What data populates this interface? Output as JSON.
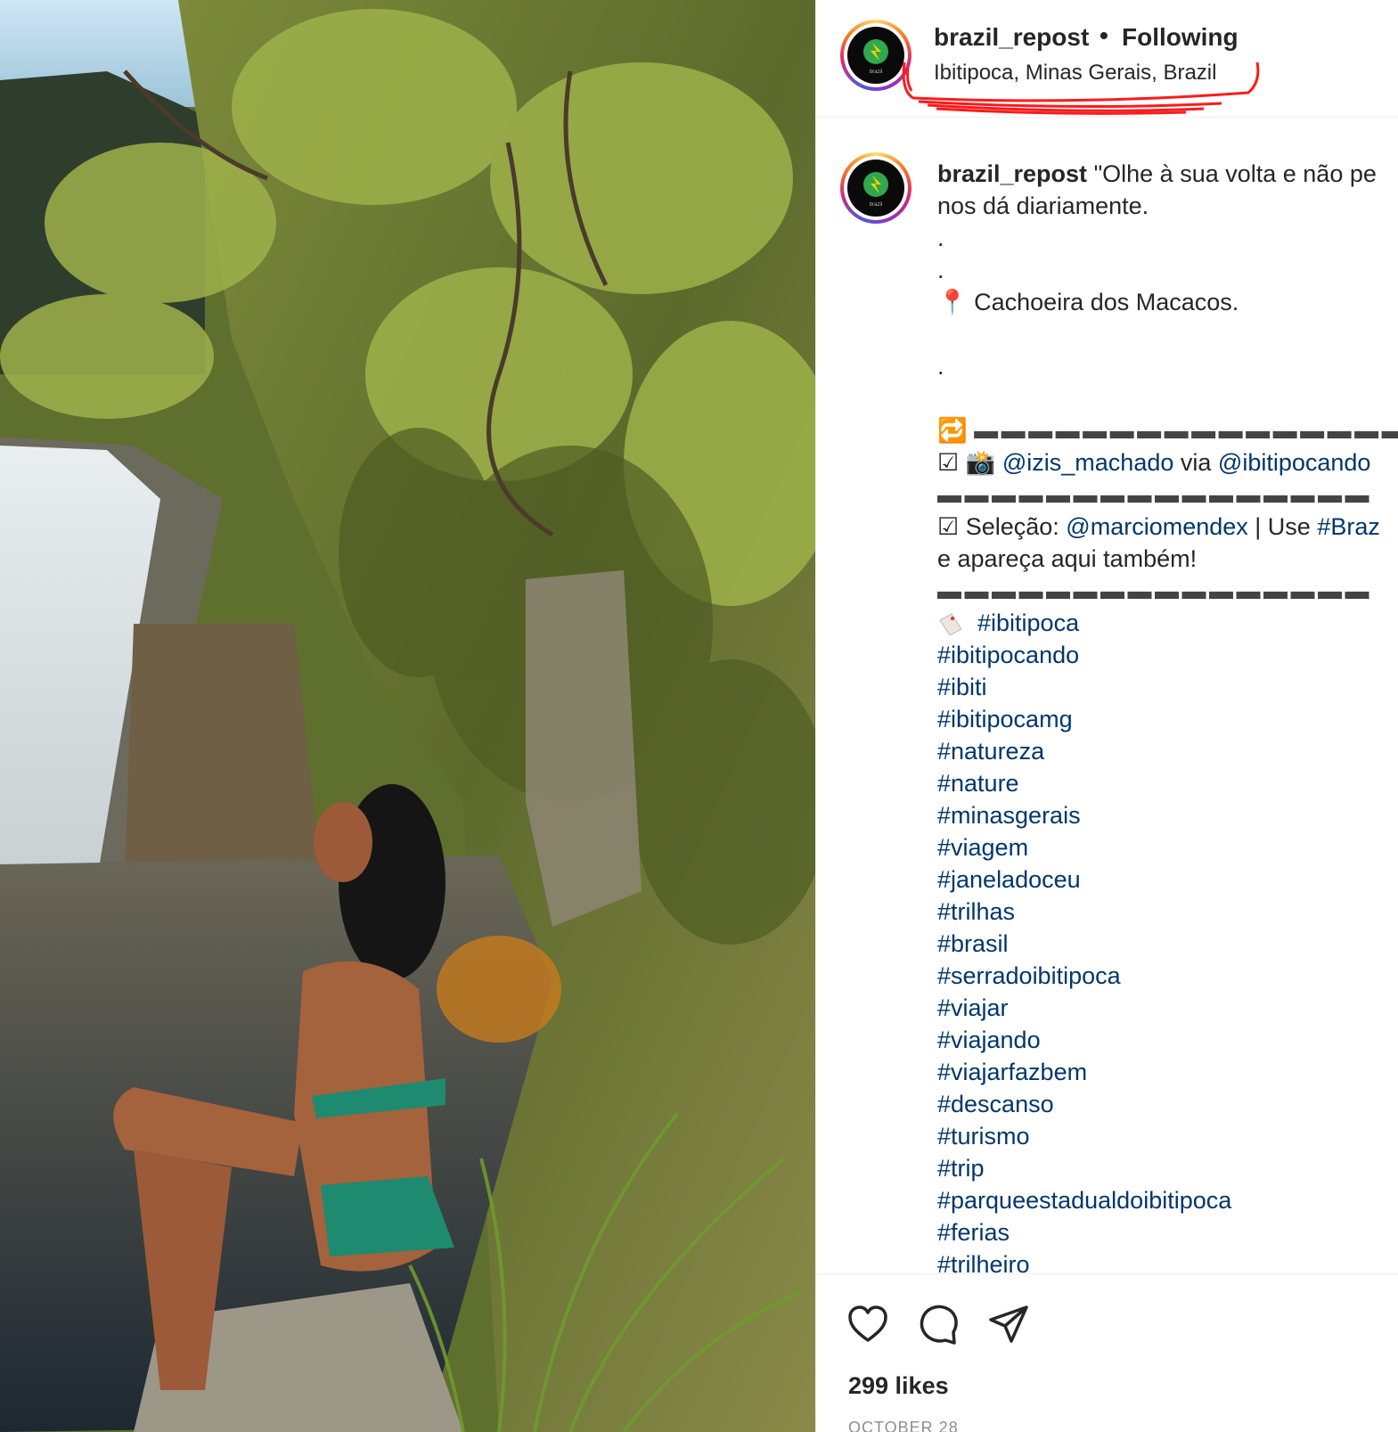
{
  "post": {
    "username": "brazil_repost",
    "separator": "•",
    "follow_state": "Following",
    "location": "Ibitipoca, Minas Gerais, Brazil",
    "avatar_text": "brazil"
  },
  "caption": {
    "username": "brazil_repost",
    "line1_text": " \"Olhe à sua volta e não pe",
    "line2_text": "nos dá diariamente.",
    "dot": ".",
    "pin_icon": "📍",
    "place": " Cachoeira dos Macacos.",
    "repost_icon": "🔁",
    "dash_line": "▬ ▬ ▬ ▬ ▬ ▬ ▬ ▬ ▬ ▬ ▬ ▬ ▬ ▬ ▬ ▬",
    "check": "☑",
    "camera_icon": "📸",
    "photo_by": "@izis_machado",
    "via": " via ",
    "via_handle": "@ibitipocando",
    "selection_label": " Seleção: ",
    "selection_handle": "@marciomendex",
    "use_text": " | Use ",
    "use_tag": "#Braz",
    "appear_text": "e apareça aqui também!",
    "hashtags": [
      "#ibitipoca",
      "#ibitipocando",
      "#ibiti",
      "#ibitipocamg",
      "#natureza",
      "#nature",
      "#minasgerais",
      "#viagem",
      "#janeladoceu",
      "#trilhas",
      "#brasil",
      "#serradoibitipoca",
      "#viajar",
      "#viajando",
      "#viajarfazbem",
      "#descanso",
      "#turismo",
      "#trip",
      "#parqueestadualdoibitipoca",
      "#ferias",
      "#trilheiro"
    ]
  },
  "actions": {
    "like_icon": "heart-icon",
    "comment_icon": "comment-icon",
    "share_icon": "paper-plane-icon"
  },
  "likes": "299 likes",
  "date": "OCTOBER 28",
  "colors": {
    "link": "#00376b",
    "scribble": "#ff1a1a",
    "text": "#262626"
  }
}
